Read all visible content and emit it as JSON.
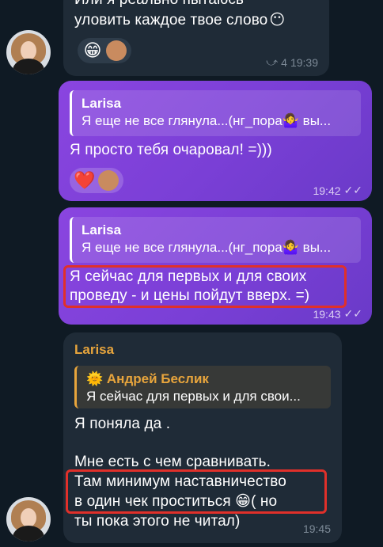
{
  "messages": [
    {
      "id": "m1",
      "direction": "incoming",
      "text_line1": "Или я реально пытаюсь",
      "text_line2": "уловить каждое твое слово",
      "text_emoji": "😶",
      "reactions": [
        "😁",
        "avatar"
      ],
      "forward_count": "4",
      "time": "19:39"
    },
    {
      "id": "m2",
      "direction": "outgoing",
      "reply_name": "Larisa",
      "reply_text": "Я еще не все глянула...(нг_пора🤷‍♀️ вы...",
      "text": "Я просто тебя очаровал! =)))",
      "reactions": [
        "❤️",
        "avatar"
      ],
      "time": "19:42"
    },
    {
      "id": "m3",
      "direction": "outgoing",
      "reply_name": "Larisa",
      "reply_text": "Я еще не все глянула...(нг_пора🤷‍♀️ вы...",
      "text_line1": "Я сейчас для первых и для своих",
      "text_line2": "проведу - и цены пойдут вверх. =)",
      "time": "19:43"
    },
    {
      "id": "m4",
      "direction": "incoming",
      "sender": "Larisa",
      "reply_name": "Андрей Беслик",
      "reply_name_emoji": "🌞",
      "reply_text": "Я сейчас для первых и для свои...",
      "text_line1": "Я поняла да .",
      "text_line2": "Мне есть с чем сравнивать.",
      "text_line3": "Там минимум наставничество",
      "text_line4": "в один чек проститься 😁( но",
      "text_line5": "ты пока этого не читал)",
      "time": "19:45"
    }
  ],
  "colors": {
    "outgoing_bubble": "#7a3fd6",
    "incoming_bubble": "#1f2b37",
    "sender_name": "#e8a53c",
    "highlight": "#e0302a"
  },
  "icons": {
    "forward": "forward-icon",
    "read_receipt": "double-check-icon"
  }
}
